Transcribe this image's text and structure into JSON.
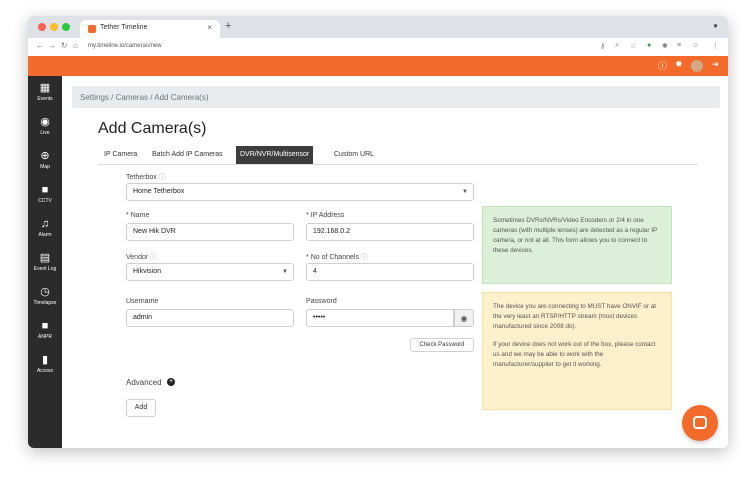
{
  "browser": {
    "tab_title": "Tether Timeline",
    "tab_close": "×",
    "new_tab": "+",
    "url": "my.timeline.io/cameras/new"
  },
  "sidebar": {
    "items": [
      {
        "label": "Events",
        "icon": "calendar-icon"
      },
      {
        "label": "Live",
        "icon": "live-icon"
      },
      {
        "label": "Map",
        "icon": "globe-icon"
      },
      {
        "label": "CCTV",
        "icon": "camera-icon"
      },
      {
        "label": "Alarm",
        "icon": "bell-icon"
      },
      {
        "label": "Event Log",
        "icon": "log-icon"
      },
      {
        "label": "Timelapse",
        "icon": "stopwatch-icon"
      },
      {
        "label": "ANPR",
        "icon": "anpr-icon"
      },
      {
        "label": "Access",
        "icon": "door-icon"
      }
    ]
  },
  "breadcrumb": "Settings / Cameras / Add Camera(s)",
  "page_title": "Add Camera(s)",
  "tabs": [
    {
      "label": "IP Camera",
      "active": false
    },
    {
      "label": "Batch Add IP Cameras",
      "active": false
    },
    {
      "label": "DVR/NVR/Multisensor",
      "active": true
    },
    {
      "label": "Custom URL",
      "active": false
    }
  ],
  "form": {
    "tetherbox_label": "Tetherbox",
    "tetherbox_value": "Home Tetherbox",
    "name_label": "Name",
    "name_value": "New Hik DVR",
    "ip_label": "IP Address",
    "ip_value": "192.168.0.2",
    "vendor_label": "Vendor",
    "vendor_value": "Hikvision",
    "channels_label": "No of Channels",
    "channels_value": "4",
    "username_label": "Username",
    "username_value": "admin",
    "password_label": "Password",
    "password_value": "•••••",
    "check_password": "Check Password",
    "advanced": "Advanced",
    "add": "Add",
    "info_mark": "ⓘ",
    "required_mark": "*"
  },
  "info_green": "Sometimes DVRs/NVRs/Video Encoders or 2/4 in one cameras (with multiple lenses) are detected as a regular IP camera, or not at all. This form allows you to connect to these devices.",
  "info_yellow_1": "The device you are connecting to MUST have ONVIF or at the very least an RTSP/HTTP stream (most devices manufactured since 2008 do).",
  "info_yellow_2": "If your device does not work out of the box, please contact us and we may be able to work with the manufacturer/supplier to get it working.",
  "colors": {
    "brand": "#f26b2a",
    "sidebar": "#2b2b2b",
    "active_tab": "#3d3d3d"
  }
}
